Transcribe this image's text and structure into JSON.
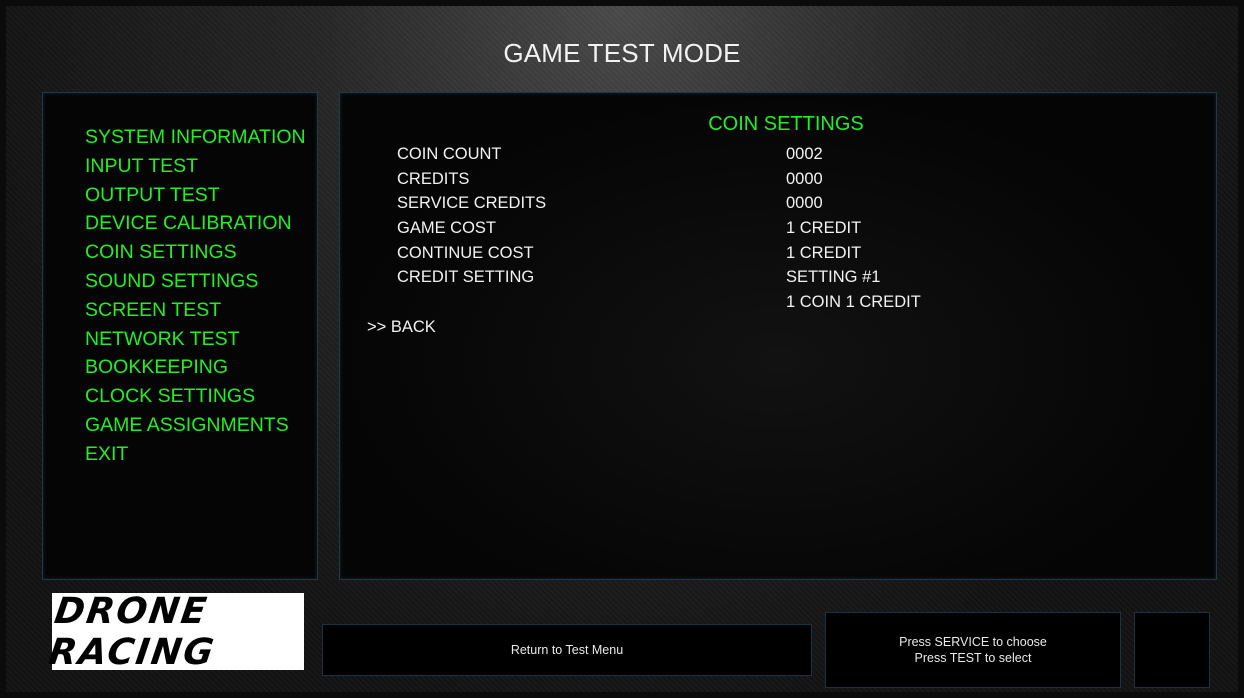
{
  "header": {
    "title": "GAME TEST MODE"
  },
  "menu": {
    "items": [
      "SYSTEM INFORMATION",
      "INPUT TEST",
      "OUTPUT TEST",
      "DEVICE CALIBRATION",
      "COIN SETTINGS",
      "SOUND SETTINGS",
      "SCREEN TEST",
      "NETWORK TEST",
      "BOOKKEEPING",
      "CLOCK SETTINGS",
      "GAME ASSIGNMENTS",
      "EXIT"
    ]
  },
  "coin_settings": {
    "title": "COIN SETTINGS",
    "rows": [
      {
        "label": "COIN COUNT",
        "value": "0002"
      },
      {
        "label": "CREDITS",
        "value": "0000"
      },
      {
        "label": "SERVICE CREDITS",
        "value": "0000"
      },
      {
        "label": "GAME COST",
        "value": "1 CREDIT"
      },
      {
        "label": "CONTINUE COST",
        "value": "1 CREDIT"
      },
      {
        "label": "CREDIT SETTING",
        "value": "SETTING #1"
      },
      {
        "label": "",
        "value": "1 COIN 1 CREDIT"
      }
    ],
    "back_label": ">> BACK"
  },
  "footer": {
    "logo_text": "DRONE RACING",
    "return_label": "Return to Test Menu",
    "hint_line1": "Press SERVICE to choose",
    "hint_line2": "Press TEST to select"
  },
  "colors": {
    "menu_text": "#22ee22",
    "value_text": "#f2f2f2",
    "panel_border": "#1d3a4a"
  }
}
